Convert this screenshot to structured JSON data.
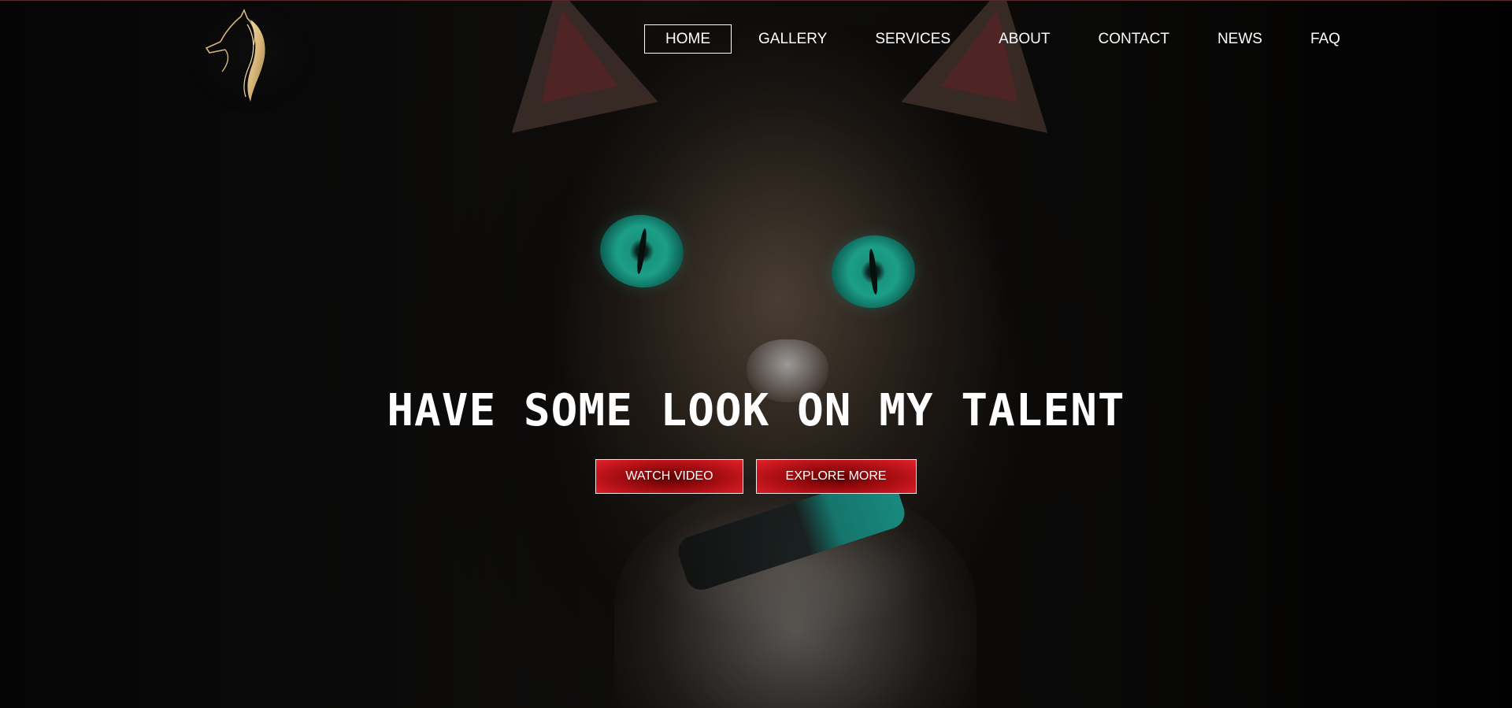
{
  "nav": {
    "items": [
      {
        "label": "HOME",
        "active": true
      },
      {
        "label": "GALLERY"
      },
      {
        "label": "SERVICES"
      },
      {
        "label": "ABOUT"
      },
      {
        "label": "CONTACT"
      },
      {
        "label": "NEWS"
      },
      {
        "label": "FAQ"
      }
    ]
  },
  "logo": {
    "icon": "horse-head-icon",
    "color": "#d8b67a"
  },
  "hero": {
    "headline": "HAVE SOME LOOK ON MY TALENT",
    "buttons": {
      "watch_video": "WATCH VIDEO",
      "explore_more": "EXPLORE MORE"
    }
  },
  "colors": {
    "button_red": "#d21a22",
    "text": "#ffffff",
    "eye_teal": "#23c2a5"
  }
}
